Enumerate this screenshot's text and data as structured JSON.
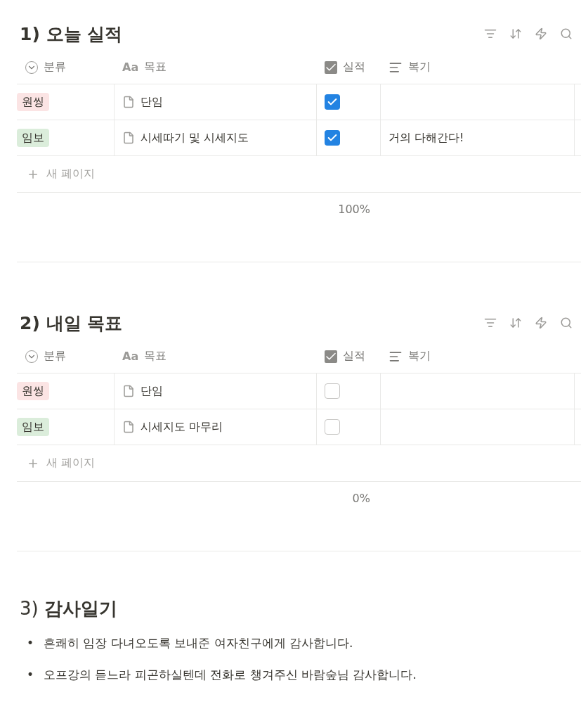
{
  "sections": [
    {
      "title": "1) 오늘 실적",
      "columns": [
        {
          "kind": "select",
          "label": "분류"
        },
        {
          "kind": "title",
          "label": "목표",
          "prefix": "Aa"
        },
        {
          "kind": "checkbox",
          "label": "실적"
        },
        {
          "kind": "text",
          "label": "복기"
        }
      ],
      "rows": [
        {
          "category": {
            "label": "원씽",
            "color": "#fbe4e4"
          },
          "goal": "단임",
          "done": true
        },
        {
          "category": {
            "label": "임보",
            "color": "#dbeddb"
          },
          "goal": "시세따기 및 시세지도",
          "done": true,
          "review": "거의 다해간다!"
        }
      ],
      "new_page": "새 페이지",
      "calc": "100%"
    },
    {
      "title": "2) 내일 목표",
      "columns": [
        {
          "kind": "select",
          "label": "분류"
        },
        {
          "kind": "title",
          "label": "목표",
          "prefix": "Aa"
        },
        {
          "kind": "checkbox",
          "label": "실적"
        },
        {
          "kind": "text",
          "label": "복기"
        }
      ],
      "rows": [
        {
          "category": {
            "label": "원씽",
            "color": "#fbe4e4"
          },
          "goal": "단임",
          "done": false
        },
        {
          "category": {
            "label": "임보",
            "color": "#dbeddb"
          },
          "goal": "시세지도 마무리",
          "done": false
        }
      ],
      "new_page": "새 페이지",
      "calc": "0%"
    }
  ],
  "gratitude": {
    "title": "3) **감사일기**",
    "items": [
      {
        "bullet": "•",
        "text": "흔쾌히 임장 다녀오도록 보내준 여자친구에게 감사합니다."
      },
      {
        "bullet": "•",
        "text": "오프강의 듣느라 피곤하실텐데 전화로 챙겨주신 바람숲님 감사합니다."
      }
    ]
  }
}
